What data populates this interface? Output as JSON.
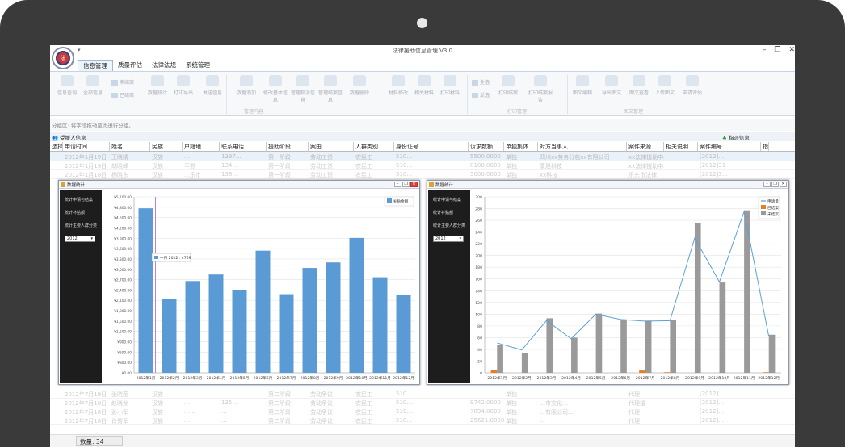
{
  "window": {
    "title": "法律援助信息管理 V3.0",
    "minimize": "–",
    "restore": "❐",
    "close": "✕"
  },
  "quick_access": "▾",
  "logo_text": "法",
  "menus": [
    "信息管理",
    "质量评估",
    "法律法规",
    "系统管理"
  ],
  "ribbon": {
    "buttons": [
      "信息查询",
      "全部信息",
      "数据统计",
      "打印导出",
      "发送信息",
      "数据添加",
      "修改基本信息",
      "管理指派信息",
      "管理结案信息",
      "数据删除",
      "材料修改",
      "相关材料",
      "打印材料",
      "打印结案",
      "打印结案报告",
      "图文编辑",
      "导出图文",
      "图文查看",
      "上传图文",
      "申请评估"
    ],
    "small_buttons": [
      "未结案",
      "已结案",
      "全选",
      "反选"
    ],
    "groups": [
      "管理内容",
      "打印管理",
      "图文管理"
    ]
  },
  "group_hint": "分组区: 将字段拖动至此进行分组。",
  "panels": {
    "left": "受援人信息",
    "right": "指派信息"
  },
  "grid": {
    "columns": [
      "选择",
      "申请时间",
      "姓名",
      "民族",
      "户籍地",
      "联系电话",
      "援助阶段",
      "案由",
      "人群类别",
      "身份证号",
      "诉求数额",
      "单独集体",
      "对方当事人",
      "案件来源",
      "相关说明",
      "案件编号",
      "指"
    ],
    "rows_top": [
      [
        "",
        "2012年1月19日",
        "王晓婧",
        "汉族",
        "…",
        "1397…",
        "第一阶段",
        "劳动工资",
        "农民工",
        "510…",
        "5500.0000",
        "单独",
        "四川xx劳务分包xx有限公司",
        "xx法律援助中心",
        "",
        "[2012]…"
      ],
      [
        "",
        "2012年1月19日",
        "胡晓峰",
        "汉族",
        "平野",
        "134…",
        "第一阶段",
        "劳动工资",
        "农民工",
        "510…",
        "8100.0000",
        "单独",
        "康晟科技",
        "xx法律援助中心",
        "",
        "[2012]31"
      ],
      [
        "",
        "2012年1月18日",
        "杨晓东",
        "汉族",
        "…乐市",
        "138…",
        "第一阶段",
        "劳动工资",
        "农民工",
        "510…",
        "5000.0000",
        "单独",
        "xx科技",
        "乐东市法律",
        "",
        "[2012]3…"
      ]
    ],
    "rows_bottom": [
      [
        "",
        "2012年7月19日",
        "张晓莹",
        "汉族",
        "…",
        "…",
        "第二阶段",
        "劳动争议",
        "农民工",
        "510…",
        "…",
        "单独",
        "…",
        "代理",
        "",
        "[2012]…"
      ],
      [
        "",
        "2012年7月18日",
        "赵晓龙",
        "汉族",
        "…",
        "135…",
        "第二阶段",
        "劳动争议",
        "农民工",
        "510…",
        "9742.0000",
        "单独",
        "…市文化…",
        "代理援",
        "",
        "[2012]…"
      ],
      [
        "",
        "2012年7月18日",
        "彭小军",
        "汉族",
        "……",
        "…",
        "第二阶段",
        "劳动争议",
        "农民工",
        "510…",
        "7894.0000",
        "单独",
        "…有限公司…",
        "代理",
        "",
        "[2012]…"
      ],
      [
        "",
        "2012年7月18日",
        "肖秀军",
        "汉族",
        "…",
        "…",
        "第二阶段",
        "劳动争议",
        "农民工",
        "510…",
        "25621.0000",
        "单独",
        "…",
        "代理",
        "",
        "[2012]…"
      ]
    ]
  },
  "status": {
    "count_label": "数量:",
    "count_value": "34"
  },
  "chart_windows": [
    {
      "title": "数据统计",
      "side_items": [
        "统计申请与结案",
        "统计补贴额",
        "统计主要人群分类"
      ],
      "year": "2012",
      "tooltip": "一月 2012 : 4769"
    },
    {
      "title": "数据统计",
      "side_items": [
        "统计申请与结案",
        "统计补贴额",
        "统计主要人群分类"
      ],
      "year": "2012"
    }
  ],
  "chart_data": [
    {
      "type": "bar",
      "categories": [
        "2012年1月",
        "2012年2月",
        "2012年3月",
        "2012年4月",
        "2012年5月",
        "2012年6月",
        "2012年7月",
        "2012年8月",
        "2012年9月",
        "2012年10月",
        "2012年11月",
        "2012年12月"
      ],
      "series": [
        {
          "name": "补贴金额",
          "values": [
            4769,
            2140,
            2660,
            2850,
            2390,
            3540,
            2280,
            3040,
            3200,
            3910,
            2770,
            2250
          ],
          "color": "#5b9bd5"
        }
      ],
      "yticks": [
        "¥0.00",
        "¥300.00",
        "¥600.00",
        "¥900.00",
        "¥1,200.00",
        "¥1,500.00",
        "¥1,800.00",
        "¥2,100.00",
        "¥2,400.00",
        "¥2,700.00",
        "¥3,000.00",
        "¥3,300.00",
        "¥3,600.00",
        "¥3,900.00",
        "¥4,200.00",
        "¥4,500.00",
        "¥4,800.00",
        "¥5,100.00"
      ],
      "ylim": [
        0,
        5100
      ],
      "grid": true,
      "legend": "top-right"
    },
    {
      "type": "bar",
      "categories": [
        "2012年1月",
        "2012年2月",
        "2012年3月",
        "2012年4月",
        "2012年5月",
        "2012年6月",
        "2012年7月",
        "2012年8月",
        "2012年9月",
        "2012年10月",
        "2012年11月",
        "2012年12月"
      ],
      "series": [
        {
          "name": "申请量",
          "kind": "line",
          "values": [
            51,
            39,
            89,
            58,
            100,
            91,
            88,
            89,
            230,
            155,
            275,
            62
          ],
          "color": "#5aa0d8"
        },
        {
          "name": "已结案",
          "kind": "bar",
          "values": [
            5,
            0,
            0,
            0,
            0,
            0,
            4,
            1,
            0,
            0,
            0,
            1
          ],
          "color": "#e67e22"
        },
        {
          "name": "未结案",
          "kind": "bar",
          "values": [
            47,
            34,
            93,
            60,
            101,
            91,
            89,
            90,
            256,
            154,
            277,
            65
          ],
          "color": "#9a9a9a"
        }
      ],
      "yticks": [
        "0",
        "20",
        "40",
        "60",
        "80",
        "100",
        "120",
        "140",
        "160",
        "180",
        "200",
        "220",
        "240",
        "260",
        "280",
        "300"
      ],
      "ylim": [
        0,
        300
      ],
      "grid": true,
      "legend": "top-right"
    }
  ]
}
